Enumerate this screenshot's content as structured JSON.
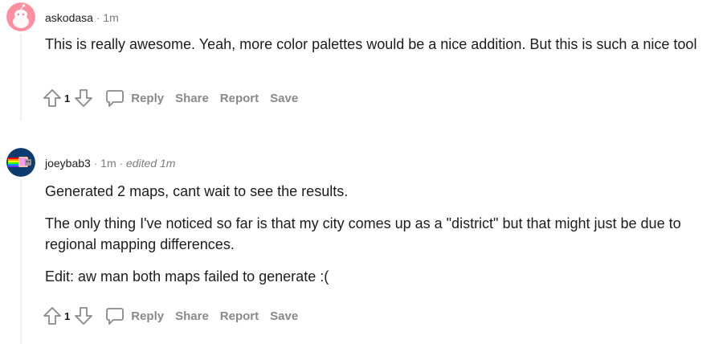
{
  "comments": [
    {
      "author": "askodasa",
      "time": "1m",
      "edited": "",
      "paragraphs": [
        "This is really awesome. Yeah, more color palettes would be a nice addition. But this is such a nice tool"
      ],
      "score": "1",
      "actions": {
        "reply": "Reply",
        "share": "Share",
        "report": "Report",
        "save": "Save"
      },
      "avatar_icon": "reddit-snoo-avatar",
      "avatar_color": "#ff8f9f"
    },
    {
      "author": "joeybab3",
      "time": "1m",
      "edited": "edited 1m",
      "paragraphs": [
        "Generated 2 maps, cant wait to see the results.",
        "The only thing I've noticed so far is that my city comes up as a \"district\" but that might just be due to regional mapping differences.",
        "Edit: aw man both maps failed to generate :("
      ],
      "score": "1",
      "actions": {
        "reply": "Reply",
        "share": "Share",
        "report": "Report",
        "save": "Save"
      },
      "avatar_icon": "nyan-cat-avatar",
      "avatar_color": "#0e3b6e"
    }
  ]
}
